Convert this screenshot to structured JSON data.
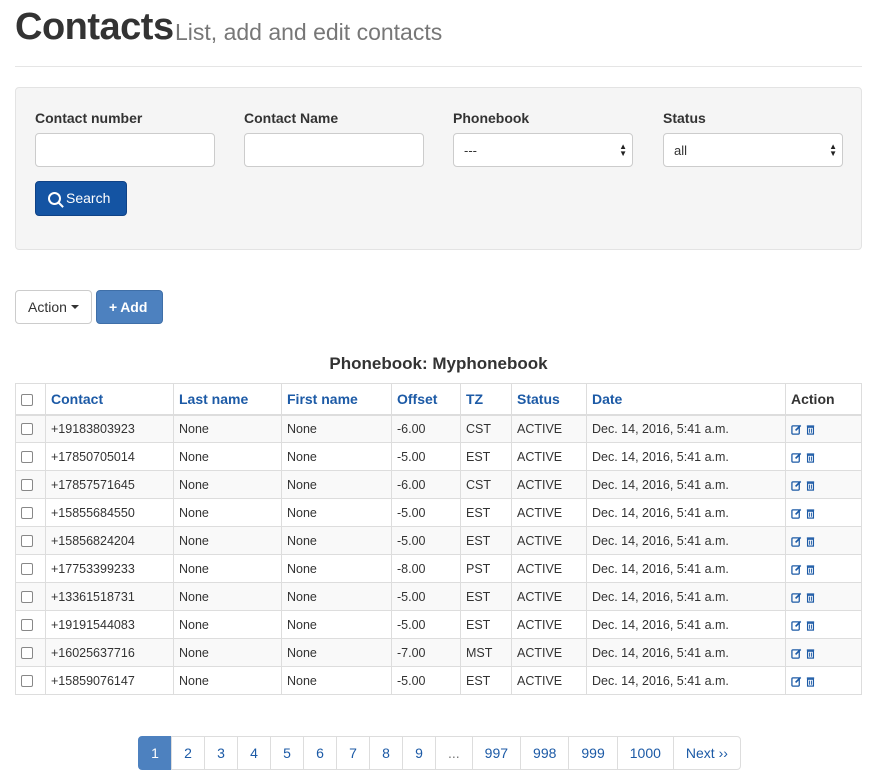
{
  "header": {
    "title": "Contacts",
    "subtitle": "List, add and edit contacts"
  },
  "filters": {
    "contact_number": {
      "label": "Contact number",
      "value": ""
    },
    "contact_name": {
      "label": "Contact Name",
      "value": ""
    },
    "phonebook": {
      "label": "Phonebook",
      "value": "---"
    },
    "status": {
      "label": "Status",
      "value": "all"
    },
    "search_label": "Search"
  },
  "toolbar": {
    "action_label": "Action",
    "add_label": "Add"
  },
  "table": {
    "caption": "Phonebook: Myphonebook",
    "columns": [
      "Contact",
      "Last name",
      "First name",
      "Offset",
      "TZ",
      "Status",
      "Date",
      "Action"
    ],
    "rows": [
      {
        "contact": "+19183803923",
        "last_name": "None",
        "first_name": "None",
        "offset": "-6.00",
        "tz": "CST",
        "status": "ACTIVE",
        "date": "Dec. 14, 2016, 5:41 a.m."
      },
      {
        "contact": "+17850705014",
        "last_name": "None",
        "first_name": "None",
        "offset": "-5.00",
        "tz": "EST",
        "status": "ACTIVE",
        "date": "Dec. 14, 2016, 5:41 a.m."
      },
      {
        "contact": "+17857571645",
        "last_name": "None",
        "first_name": "None",
        "offset": "-6.00",
        "tz": "CST",
        "status": "ACTIVE",
        "date": "Dec. 14, 2016, 5:41 a.m."
      },
      {
        "contact": "+15855684550",
        "last_name": "None",
        "first_name": "None",
        "offset": "-5.00",
        "tz": "EST",
        "status": "ACTIVE",
        "date": "Dec. 14, 2016, 5:41 a.m."
      },
      {
        "contact": "+15856824204",
        "last_name": "None",
        "first_name": "None",
        "offset": "-5.00",
        "tz": "EST",
        "status": "ACTIVE",
        "date": "Dec. 14, 2016, 5:41 a.m."
      },
      {
        "contact": "+17753399233",
        "last_name": "None",
        "first_name": "None",
        "offset": "-8.00",
        "tz": "PST",
        "status": "ACTIVE",
        "date": "Dec. 14, 2016, 5:41 a.m."
      },
      {
        "contact": "+13361518731",
        "last_name": "None",
        "first_name": "None",
        "offset": "-5.00",
        "tz": "EST",
        "status": "ACTIVE",
        "date": "Dec. 14, 2016, 5:41 a.m."
      },
      {
        "contact": "+19191544083",
        "last_name": "None",
        "first_name": "None",
        "offset": "-5.00",
        "tz": "EST",
        "status": "ACTIVE",
        "date": "Dec. 14, 2016, 5:41 a.m."
      },
      {
        "contact": "+16025637716",
        "last_name": "None",
        "first_name": "None",
        "offset": "-7.00",
        "tz": "MST",
        "status": "ACTIVE",
        "date": "Dec. 14, 2016, 5:41 a.m."
      },
      {
        "contact": "+15859076147",
        "last_name": "None",
        "first_name": "None",
        "offset": "-5.00",
        "tz": "EST",
        "status": "ACTIVE",
        "date": "Dec. 14, 2016, 5:41 a.m."
      }
    ],
    "action_icons": [
      "edit-icon",
      "trash-icon"
    ]
  },
  "pagination": {
    "pages": [
      "1",
      "2",
      "3",
      "4",
      "5",
      "6",
      "7",
      "8",
      "9",
      "...",
      "997",
      "998",
      "999",
      "1000"
    ],
    "current": "1",
    "next_label": "Next ››"
  },
  "colors": {
    "primary": "#1454a3",
    "accent": "#4d81bf",
    "link": "#1c5aa6"
  }
}
